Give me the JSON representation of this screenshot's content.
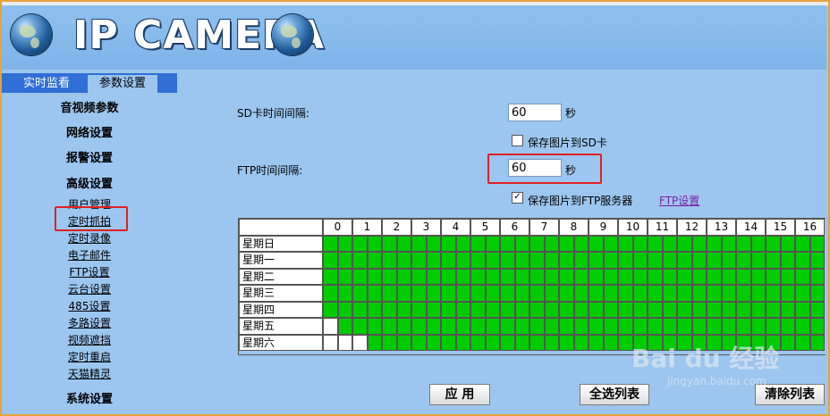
{
  "header": {
    "title": "IP CAMERA"
  },
  "tabs": [
    {
      "label": "实时监看"
    },
    {
      "label": "参数设置"
    }
  ],
  "menu": {
    "audio_video": "音视频参数",
    "network": "网络设置",
    "alarm": "报警设置",
    "advanced": "高级设置",
    "sub": [
      "用户管理",
      "定时抓拍",
      "定时录像",
      "电子邮件",
      "FTP设置",
      "云台设置",
      "485设置",
      "多路设置",
      "视频遮挡",
      "定时重启",
      "天猫精灵"
    ],
    "system": "系统设置"
  },
  "form": {
    "sd_interval_label": "SD卡时间间隔:",
    "sd_interval_value": "60",
    "sd_unit": "秒",
    "save_sd_label": "保存图片到SD卡",
    "save_sd_checked": false,
    "ftp_interval_label": "FTP时间间隔:",
    "ftp_interval_value": "60",
    "ftp_unit": "秒",
    "save_ftp_label": "保存图片到FTP服务器",
    "save_ftp_checked": true,
    "ftp_settings_link": "FTP设置"
  },
  "schedule": {
    "hours": [
      "0",
      "1",
      "2",
      "3",
      "4",
      "5",
      "6",
      "7",
      "8",
      "9",
      "10",
      "11",
      "12",
      "13",
      "14",
      "15",
      "16"
    ],
    "days": [
      "星期日",
      "星期一",
      "星期二",
      "星期三",
      "星期四",
      "星期五",
      "星期六"
    ],
    "off_cells": {
      "星期五": [
        0
      ],
      "星期六": [
        0,
        1,
        2
      ]
    }
  },
  "buttons": {
    "apply": "应 用",
    "select_all": "全选列表",
    "clear": "清除列表"
  },
  "watermark": {
    "brand": "Bai du 经验",
    "url": "jingyan.baidu.com"
  },
  "colors": {
    "accent": "#2f6fd6",
    "background": "#9cc6ef",
    "active_cell": "#00cc00",
    "highlight": "#e02020"
  }
}
